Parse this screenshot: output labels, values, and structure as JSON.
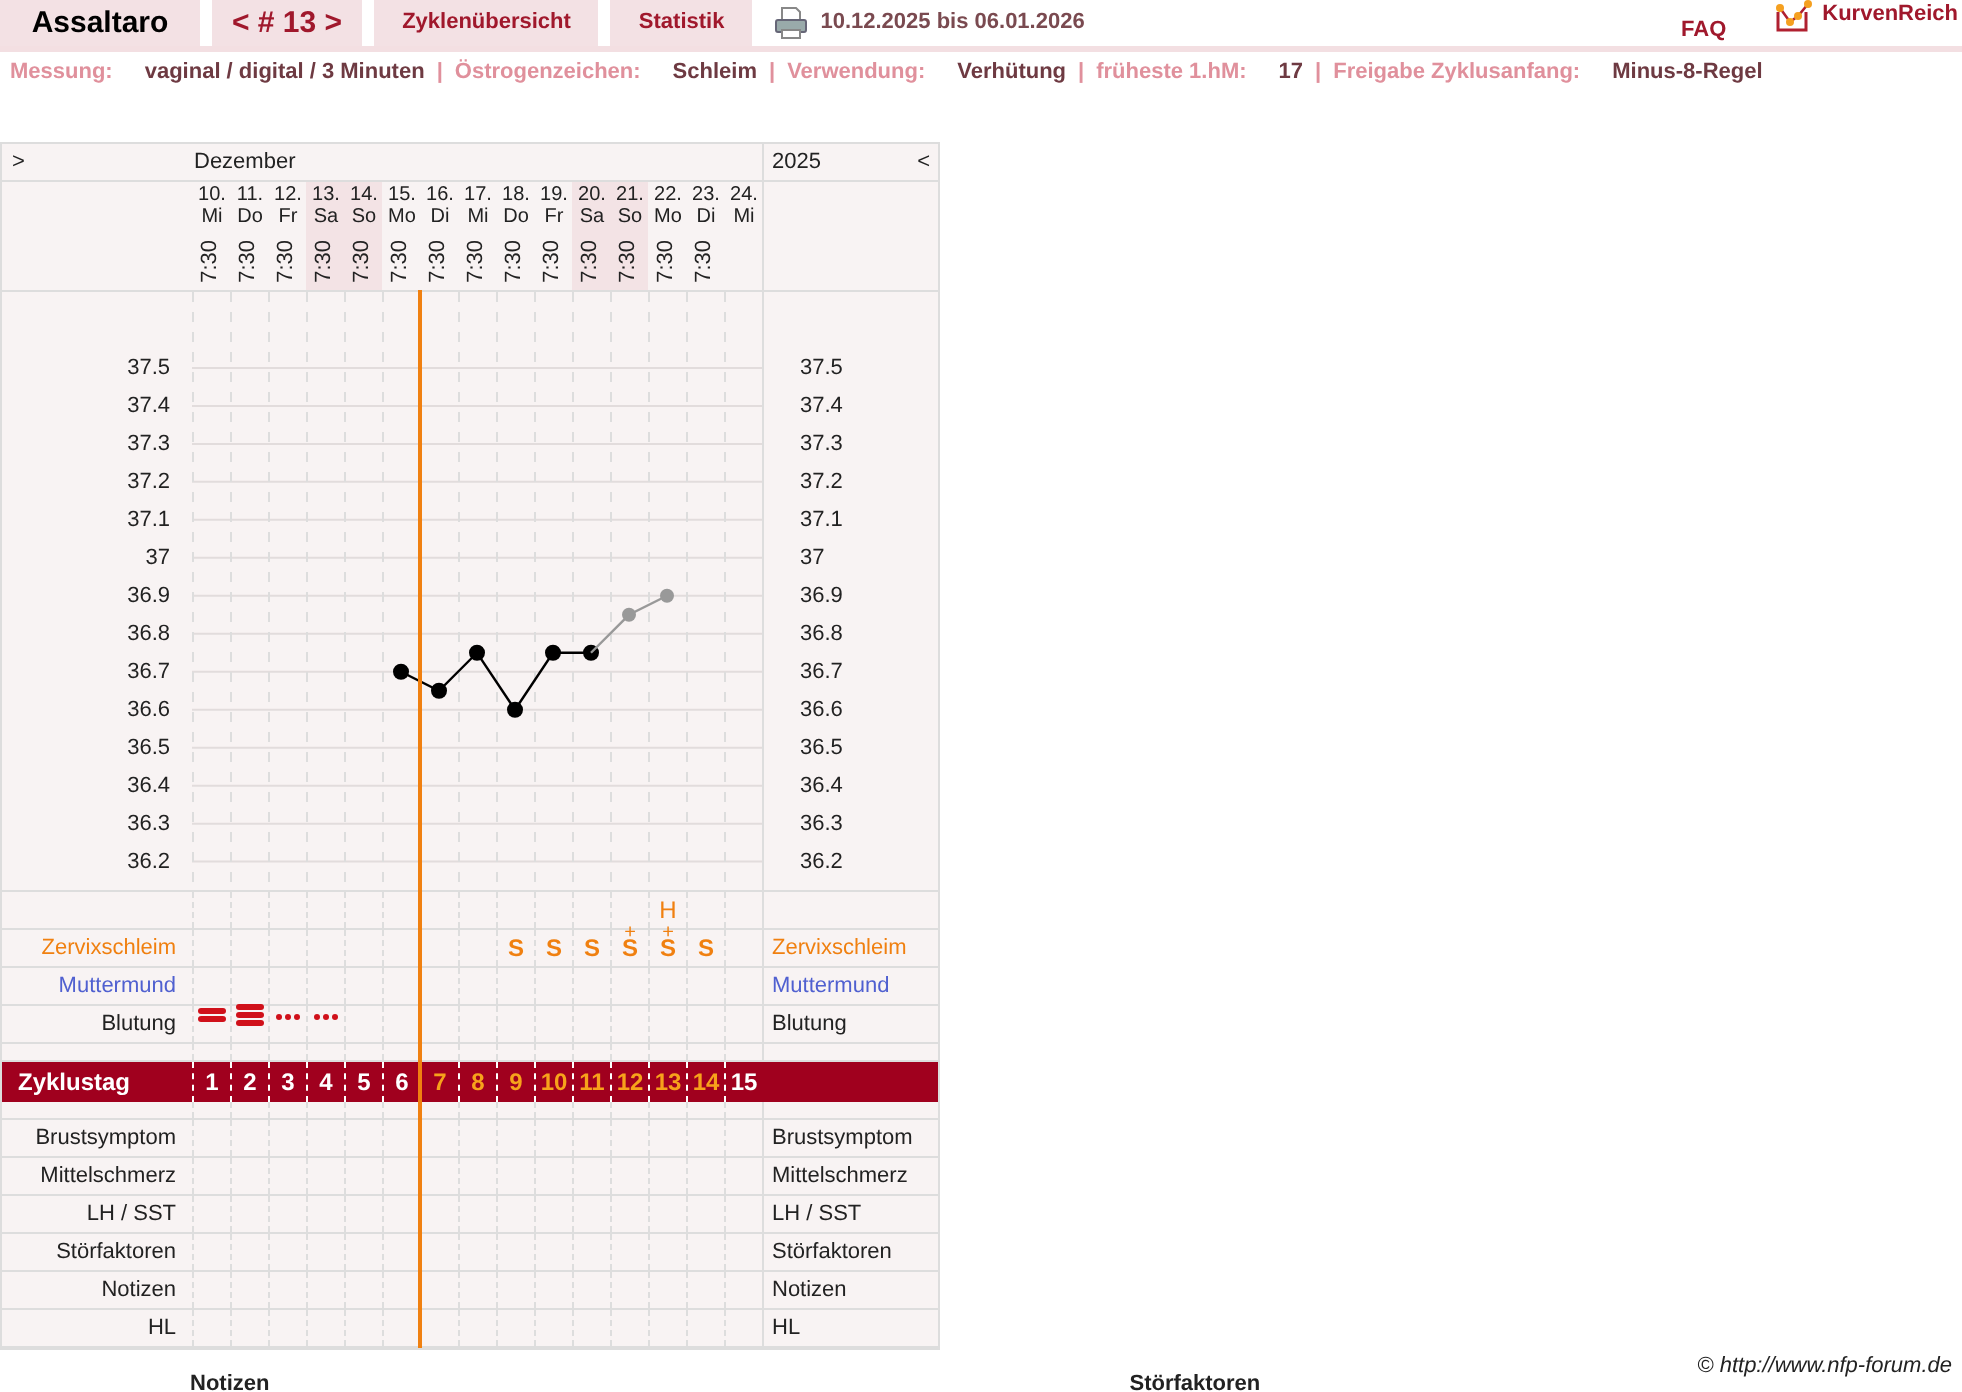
{
  "app": {
    "title": "Assaltaro"
  },
  "nav_tabs": [
    {
      "label": "< # 13 >",
      "kind": "cycle"
    },
    {
      "label": "Zyklenübersicht",
      "kind": "page"
    },
    {
      "label": "Statistik",
      "kind": "page"
    }
  ],
  "date_range": "10.12.2025 bis 06.01.2026",
  "faq": "FAQ",
  "brand": "KurvenReich",
  "settings": [
    {
      "label": "Messung:",
      "value": "vaginal / digital / 3 Minuten"
    },
    {
      "separator": "|",
      "label": "Östrogenzeichen:",
      "value": "Schleim"
    },
    {
      "separator": "|",
      "label": "Verwendung:",
      "value": "Verhütung"
    },
    {
      "separator": "|",
      "label": "früheste 1.hM:",
      "value": "17"
    },
    {
      "separator": "|",
      "label": "Freigabe Zyklusanfang:",
      "value": "Minus-8-Regel"
    }
  ],
  "chart": {
    "next_nav": ">",
    "month": "Dezember",
    "year": "2025",
    "prev_nav": "<",
    "days": [
      {
        "date": "10.",
        "weekday": "Mi",
        "time": "7:30",
        "weekend": false,
        "cycle_day": "1",
        "fertile": false,
        "release_line": false,
        "bleeding": {
          "kind": "strong"
        }
      },
      {
        "date": "11.",
        "weekday": "Do",
        "time": "7:30",
        "weekend": false,
        "cycle_day": "2",
        "fertile": false,
        "release_line": false,
        "bleeding": {
          "kind": "very_strong"
        }
      },
      {
        "date": "12.",
        "weekday": "Fr",
        "time": "7:30",
        "weekend": false,
        "cycle_day": "3",
        "fertile": false,
        "release_line": false,
        "bleeding": {
          "kind": "spotting"
        }
      },
      {
        "date": "13.",
        "weekday": "Sa",
        "time": "7:30",
        "weekend": true,
        "cycle_day": "4",
        "fertile": false,
        "release_line": false,
        "bleeding": {
          "kind": "spotting"
        }
      },
      {
        "date": "14.",
        "weekday": "So",
        "time": "7:30",
        "weekend": true,
        "cycle_day": "5",
        "fertile": false,
        "release_line": false
      },
      {
        "date": "15.",
        "weekday": "Mo",
        "time": "7:30",
        "weekend": false,
        "cycle_day": "6",
        "fertile": false,
        "release_line": true
      },
      {
        "date": "16.",
        "weekday": "Di",
        "time": "7:30",
        "weekend": false,
        "cycle_day": "7",
        "fertile": true,
        "release_line": false
      },
      {
        "date": "17.",
        "weekday": "Mi",
        "time": "7:30",
        "weekend": false,
        "cycle_day": "8",
        "fertile": true,
        "release_line": false
      },
      {
        "date": "18.",
        "weekday": "Do",
        "time": "7:30",
        "weekend": false,
        "cycle_day": "9",
        "fertile": true,
        "release_line": false,
        "mucus": "S"
      },
      {
        "date": "19.",
        "weekday": "Fr",
        "time": "7:30",
        "weekend": false,
        "cycle_day": "10",
        "fertile": true,
        "release_line": false,
        "mucus": "S"
      },
      {
        "date": "20.",
        "weekday": "Sa",
        "time": "7:30",
        "weekend": true,
        "cycle_day": "11",
        "fertile": true,
        "release_line": false,
        "mucus": "S"
      },
      {
        "date": "21.",
        "weekday": "So",
        "time": "7:30",
        "weekend": true,
        "cycle_day": "12",
        "fertile": true,
        "release_line": false,
        "mucus": "S",
        "mucus_plus": "+"
      },
      {
        "date": "22.",
        "weekday": "Mo",
        "time": "7:30",
        "weekend": false,
        "cycle_day": "13",
        "fertile": true,
        "release_line": false,
        "mucus": "S",
        "mucus_plus": "+",
        "peak": "H"
      },
      {
        "date": "23.",
        "weekday": "Di",
        "time": "7:30",
        "weekend": false,
        "cycle_day": "14",
        "fertile": true,
        "release_line": false,
        "mucus": "S"
      },
      {
        "date": "24.",
        "weekday": "Mi",
        "weekend": false,
        "cycle_day": "15",
        "fertile": false,
        "release_line": false
      }
    ],
    "temperature": {
      "chart_data": {
        "type": "line",
        "categories": [
          null,
          null,
          null,
          null,
          null,
          null,
          null,
          null,
          null,
          null,
          null,
          null,
          null,
          null,
          null
        ],
        "series": [
          {
            "color": "#000000",
            "marker": "o",
            "values": [
              null,
              null,
              null,
              null,
              null,
              36.7,
              36.65,
              36.75,
              36.6,
              36.75,
              36.75,
              null,
              null,
              null,
              null
            ]
          },
          {
            "color": "#999999",
            "marker": "o",
            "values": [
              null,
              null,
              null,
              null,
              null,
              null,
              null,
              null,
              null,
              null,
              36.75,
              36.85,
              36.9,
              null,
              null
            ]
          }
        ],
        "ylim": [
          36.12,
          37.7
        ],
        "grid": true,
        "yticks": [
          36.2,
          36.3,
          36.4,
          36.5,
          36.6,
          36.7,
          36.8,
          36.9,
          37,
          37.1,
          37.2,
          37.3,
          37.4,
          37.5
        ]
      },
      "right_axis_labels": [
        "37.5",
        "37.4",
        "37.3",
        "37.2",
        "37.1",
        "37",
        "36.9",
        "36.8",
        "36.7",
        "36.6",
        "36.5",
        "36.4",
        "36.3",
        "36.2"
      ]
    },
    "rows_top": [
      {
        "kind": "mucus",
        "label": "Zervixschleim",
        "label_right": "Zervixschleim"
      },
      {
        "kind": "cervix",
        "label": "Muttermund",
        "label_right": "Muttermund"
      },
      {
        "kind": "bleeding",
        "label": "Blutung",
        "label_right": "Blutung"
      }
    ],
    "cycle_day_label": "Zyklustag",
    "rows_bottom": [
      {
        "label": "Brustsymptom",
        "label_right": "Brustsymptom"
      },
      {
        "label": "Mittelschmerz",
        "label_right": "Mittelschmerz"
      },
      {
        "label": "LH / SST",
        "label_right": "LH / SST"
      },
      {
        "label": "Störfaktoren",
        "label_right": "Störfaktoren"
      },
      {
        "label": "Notizen",
        "label_right": "Notizen"
      },
      {
        "label": "HL",
        "label_right": "HL"
      }
    ]
  },
  "copyright": "© http://www.nfp-forum.de",
  "sections": [
    "Notizen",
    "Störfaktoren"
  ]
}
